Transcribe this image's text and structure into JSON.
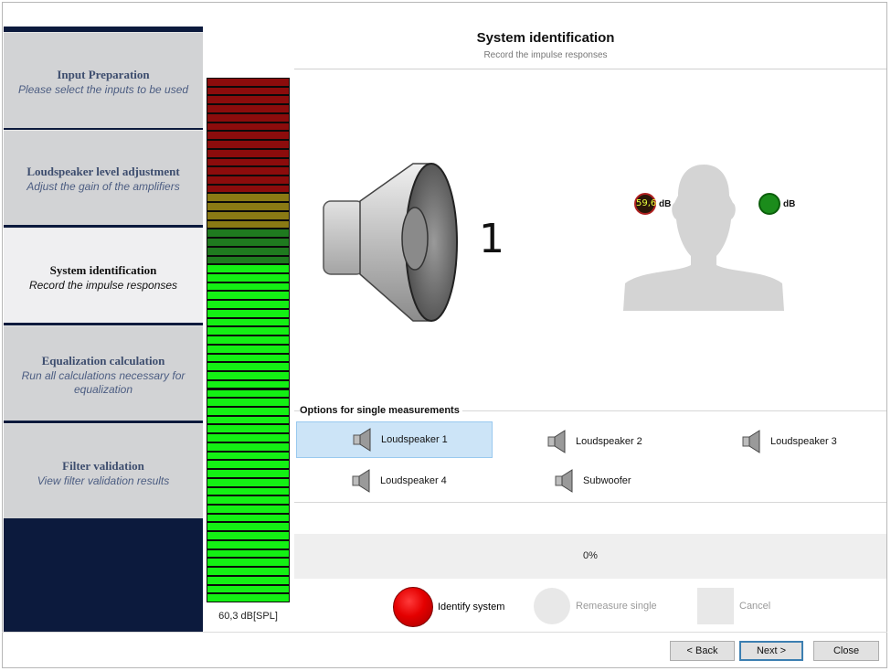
{
  "header": {
    "title": "System identification",
    "subtitle": "Record the impulse responses"
  },
  "steps": [
    {
      "title": "Input Preparation",
      "subtitle": "Please select the inputs to be used"
    },
    {
      "title": "Loudspeaker level adjustment",
      "subtitle": "Adjust the gain of the amplifiers"
    },
    {
      "title": "System identification",
      "subtitle": "Record the impulse responses"
    },
    {
      "title": "Equalization calculation",
      "subtitle": "Run all calculations necessary for equalization"
    },
    {
      "title": "Filter validation",
      "subtitle": "View filter validation results"
    }
  ],
  "active_step": 2,
  "meter": {
    "label": "60,3 dB[SPL]",
    "segment_states": [
      "bright-green:38",
      "dark-green:4",
      "dark-yellow:4",
      "dark-red:13"
    ]
  },
  "visual": {
    "speaker_number": "1",
    "left_ear_value": "59,6",
    "left_ear_unit": "dB",
    "right_ear_unit": "dB",
    "colors": {
      "left_ear": "#b02121",
      "right_ear": "#1b8c1b",
      "speaker": "#8a8a8a",
      "head": "#d4d4d4"
    }
  },
  "options": {
    "title": "Options for single measurements",
    "speakers": [
      {
        "label": "Loudspeaker 1",
        "selected": true
      },
      {
        "label": "Loudspeaker 2",
        "selected": false
      },
      {
        "label": "Loudspeaker 3",
        "selected": false
      },
      {
        "label": "Loudspeaker 4",
        "selected": false
      },
      {
        "label": "Subwoofer",
        "selected": false
      }
    ]
  },
  "progress": {
    "text": "0%",
    "value": 0
  },
  "actions": {
    "identify": "Identify system",
    "remeasure": "Remeasure single",
    "cancel": "Cancel"
  },
  "footer": {
    "back": "< Back",
    "next": "Next >",
    "close": "Close"
  }
}
